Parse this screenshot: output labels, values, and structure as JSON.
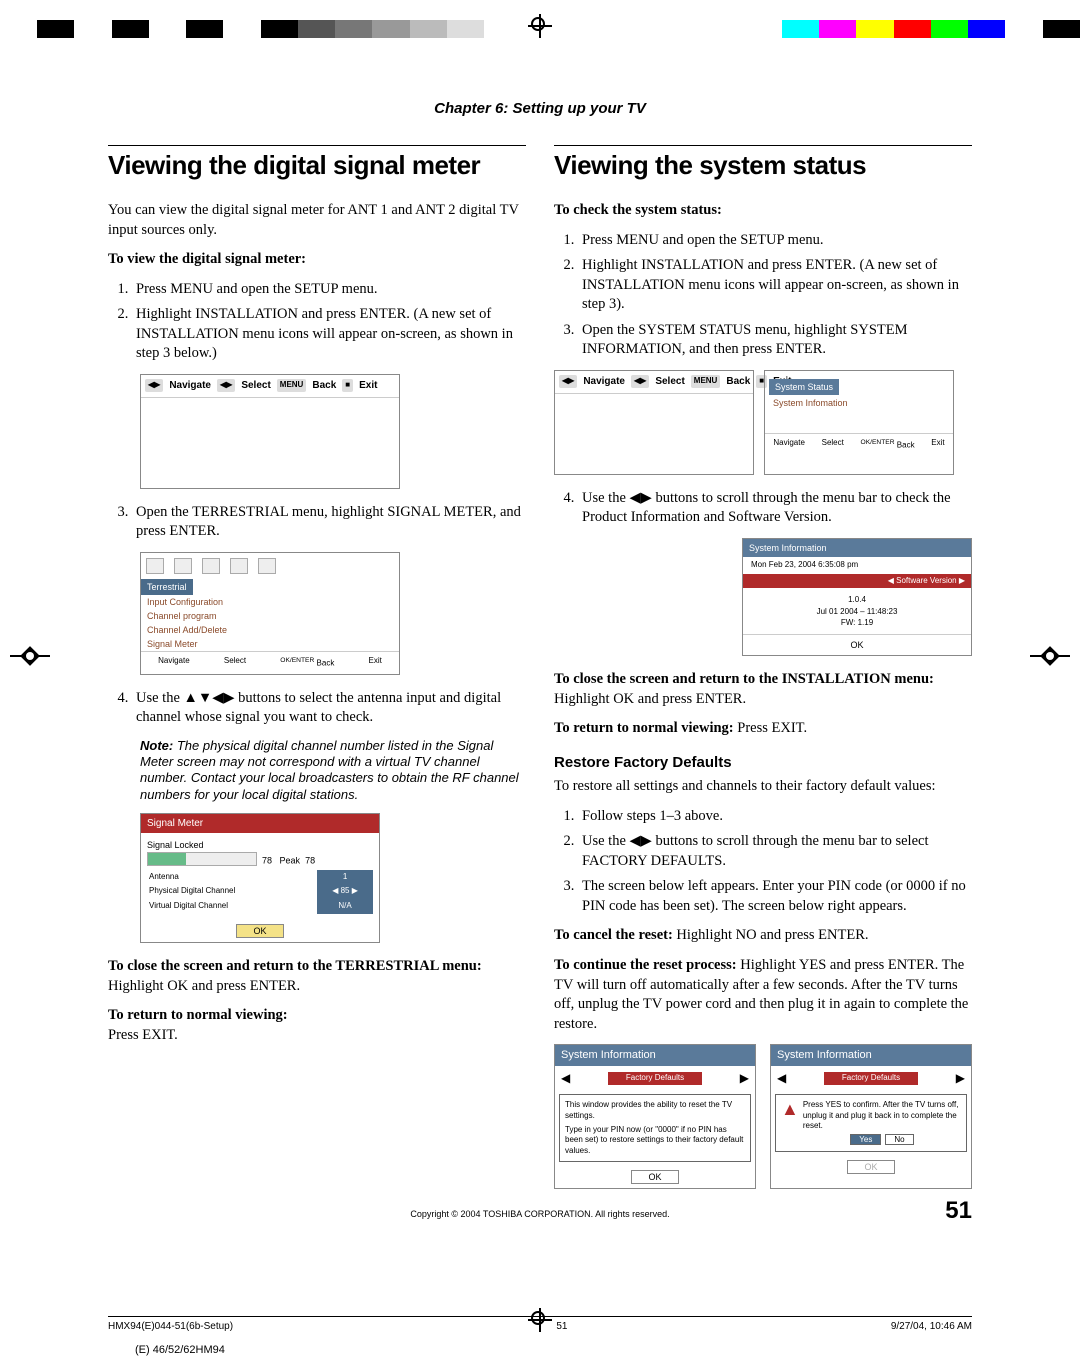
{
  "chapter": "Chapter 6: Setting up your TV",
  "left": {
    "heading": "Viewing the digital signal meter",
    "intro": "You can view the digital signal meter for ANT 1 and ANT 2 digital TV input sources only.",
    "sub1": "To view the digital signal meter:",
    "step1": "Press MENU and open the SETUP menu.",
    "step2": "Highlight INSTALLATION and press ENTER. (A new set of INSTALLATION menu icons will appear on-screen, as shown in step 3 below.)",
    "nav": {
      "navigate": "Navigate",
      "select": "Select",
      "back": "Back",
      "exit": "Exit",
      "menu": "MENU",
      "okenter": "OK/ENTER"
    },
    "step3": "Open the TERRESTRIAL menu, highlight SIGNAL METER, and press ENTER.",
    "terrestrial": {
      "tab": "Terrestrial",
      "items": [
        "Input Configuration",
        "Channel program",
        "Channel Add/Delete",
        "Signal Meter"
      ]
    },
    "step4_a": "Use the ",
    "step4_b": " buttons to select the antenna input and digital channel whose signal you want to check.",
    "note_label": "Note:",
    "note": "The physical digital channel number listed in the Signal Meter screen may not correspond with a virtual TV channel number. Contact your local broadcasters to obtain the RF channel numbers for your local digital stations.",
    "sigmeter": {
      "title": "Signal Meter",
      "locked": "Signal Locked",
      "val": "78",
      "peak": "Peak",
      "pval": "78",
      "antenna": "Antenna",
      "aval": "1",
      "pdc": "Physical Digital Channel",
      "pdcval": "85",
      "vdc": "Virtual Digital Channel",
      "vdcval": "N/A",
      "ok": "OK"
    },
    "close_label": "To close the screen and return to the TERRESTRIAL menu:",
    "close_text": "Highlight OK and press ENTER.",
    "return_label": "To return to normal viewing:",
    "return_text": "Press EXIT."
  },
  "right": {
    "heading": "Viewing the system status",
    "sub1": "To check the system status:",
    "step1": "Press MENU and open the SETUP menu.",
    "step2": "Highlight INSTALLATION and press ENTER. (A new set of INSTALLATION menu icons will appear on-screen, as shown in step 3).",
    "step3": "Open the SYSTEM STATUS menu, highlight SYSTEM INFORMATION, and then press ENTER.",
    "sysstatus": {
      "tab": "System Status",
      "item": "System Infomation"
    },
    "step4_a": "Use the ",
    "step4_b": " buttons to scroll through the menu bar to check the Product Information and Software Version.",
    "sysinfo": {
      "title": "System Information",
      "date": "Mon Feb 23, 2004   6:35:08 pm",
      "sv": "Software Version",
      "v1": "1.0.4",
      "v2": "Jul 01 2004 – 11:48:23",
      "v3": "FW: 1.19",
      "ok": "OK"
    },
    "close_a": "To close the screen and return to the INSTALLATION menu:",
    "close_b": "Highlight OK and press ENTER.",
    "return_a": "To return to normal viewing:",
    "return_b": "Press EXIT.",
    "restore_heading": "Restore Factory Defaults",
    "restore_intro": "To restore all settings and channels to their factory default values:",
    "r1": "Follow steps 1–3 above.",
    "r2_a": "Use the ",
    "r2_b": " buttons to scroll through the menu bar to select FACTORY DEFAULTS.",
    "r3": "The screen below left appears. Enter your PIN code (or 0000 if no PIN code has been set). The screen below right appears.",
    "cancel_a": "To cancel the reset:",
    "cancel_b": "Highlight NO and press ENTER.",
    "cont_a": "To continue the reset process:",
    "cont_b": "Highlight YES and press ENTER. The TV will turn off automatically after a few seconds. After the TV turns off, unplug the TV power cord and then plug it in again to complete the restore.",
    "factory": {
      "title": "System Information",
      "tab": "Factory Defaults",
      "msg1a": "This window provides the ability to reset the TV settings.",
      "msg1b": "Type in your PIN now (or \"0000\" if no PIN has been set) to restore settings to their factory default values.",
      "msg2": "Press YES to confirm. After the TV turns off, unplug it and plug it back in to complete the reset.",
      "ok": "OK",
      "yes": "Yes",
      "no": "No"
    }
  },
  "copyright": "Copyright © 2004 TOSHIBA CORPORATION. All rights reserved.",
  "pagenum": "51",
  "foot": {
    "left": "HMX94(E)044-51(6b-Setup)",
    "mid": "51",
    "right": "9/27/04, 10:46 AM"
  },
  "bottom_mark": "(E) 46/52/62HM94",
  "colorbar": [
    "#fff",
    "#000",
    "#fff",
    "#000",
    "#fff",
    "#000",
    "#fff",
    "#000",
    "#555",
    "#777",
    "#999",
    "#bbb",
    "#ddd",
    "#fff",
    "#fff",
    "#fff",
    "#fff",
    "#fff",
    "#fff",
    "#fff",
    "#fff",
    "#0ff",
    "#f0f",
    "#ff0",
    "#f00",
    "#0f0",
    "#00f",
    "#fff",
    "#000"
  ]
}
